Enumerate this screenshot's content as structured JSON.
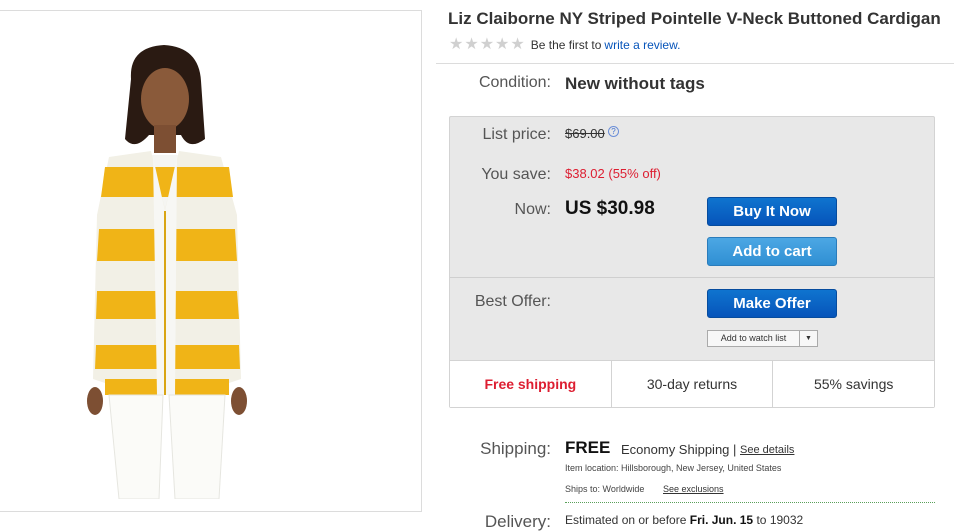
{
  "product": {
    "title": "Liz Claiborne NY Striped Pointelle V-Neck Buttoned Cardigan",
    "image_alt": "Woman wearing yellow and white striped cardigan"
  },
  "rating": {
    "stars_filled": 0,
    "stars_total": 5,
    "prompt": "Be the first to",
    "link": "write a review."
  },
  "condition": {
    "label": "Condition:",
    "value": "New without tags"
  },
  "pricing": {
    "list_label": "List price:",
    "list_value": "$69.00",
    "info_icon": "?",
    "save_label": "You save:",
    "save_value": "$38.02 (55% off)",
    "now_label": "Now:",
    "now_value": "US $30.98"
  },
  "buttons": {
    "buy": "Buy It Now",
    "cart": "Add to cart",
    "offer": "Make Offer",
    "watch": "Add to watch list"
  },
  "best_offer": {
    "label": "Best Offer:"
  },
  "benefits": [
    "Free shipping",
    "30-day returns",
    "55% savings"
  ],
  "shipping": {
    "label": "Shipping:",
    "free": "FREE",
    "service": "Economy Shipping |",
    "details": "See details",
    "item_location": "Item location:  Hillsborough, New Jersey, United States",
    "ships_to": "Ships to:  Worldwide",
    "exclusions": "See exclusions"
  },
  "delivery": {
    "label": "Delivery:",
    "prefix": "Estimated on or before",
    "date": "Fri. Jun. 15",
    "middle": "to",
    "zip": "19032"
  },
  "colors": {
    "primary_button": "#0654ba",
    "cart_button": "#3597da",
    "sale_red": "#dd1e31",
    "link_blue": "#0654ba",
    "box_gray": "#e8e8e8"
  }
}
